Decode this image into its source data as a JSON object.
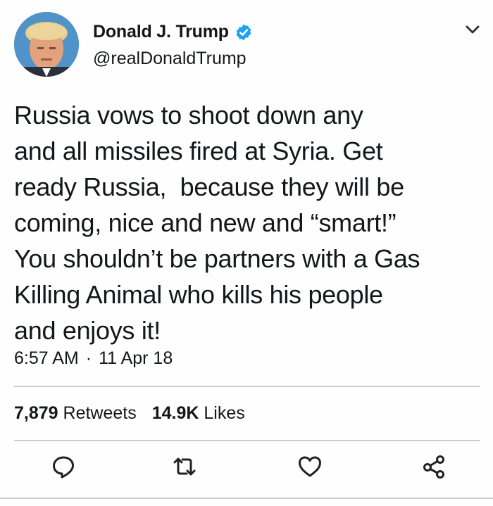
{
  "author": {
    "display_name": "Donald J. Trump",
    "handle": "@realDonaldTrump",
    "verified": true
  },
  "tweet": {
    "lines": [
      "Russia vows to shoot down any",
      "and all missiles fired at Syria. Get",
      "ready Russia,  because they will be",
      "coming, nice and new and “smart!”",
      "You shouldn’t be partners with a Gas",
      "Killing Animal who kills his people",
      "and enjoys it!"
    ],
    "time": "6:57 AM",
    "separator": "·",
    "date": "11 Apr 18"
  },
  "stats": {
    "retweets_count": "7,879",
    "retweets_label": "Retweets",
    "likes_count": "14.9K",
    "likes_label": "Likes"
  },
  "actions": [
    "reply-icon",
    "retweet-icon",
    "like-icon",
    "share-icon"
  ],
  "colors": {
    "verified": "#1da1f2",
    "icon": "#222222",
    "divider": "#c8ced3"
  }
}
